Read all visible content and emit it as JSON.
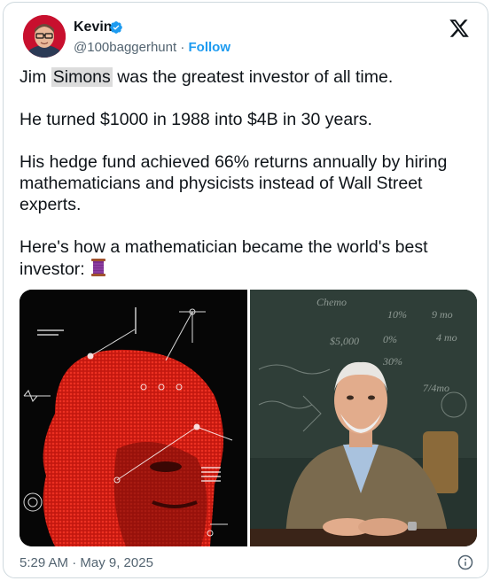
{
  "author": {
    "name": "Kevin",
    "handle": "@100baggerhunt",
    "separator": "·",
    "follow_label": "Follow"
  },
  "tweet": {
    "line1_pre": "Jim ",
    "line1_highlight": "Simons",
    "line1_post": " was the greatest investor of all time.",
    "paragraph2": "He turned $1000 in 1988 into $4B in 30 years.",
    "paragraph3": "His hedge fund achieved 66% returns annually by hiring mathematicians and physicists instead of Wall Street experts.",
    "paragraph4": "Here's how a mathematician became the world's best investor:"
  },
  "media": {
    "left_image": "red-halftone-portrait",
    "right_image": "portrait-at-chalkboard",
    "chalk_text": [
      "Chemo",
      "10%",
      "9 mo",
      "0%",
      "4 mo",
      "30%",
      "7/4mo",
      "$5,000"
    ]
  },
  "footer": {
    "timestamp": "5:29 AM · May 9, 2025"
  },
  "icons": {
    "verified": "verified-badge-icon",
    "x": "x-logo-icon",
    "info": "info-icon",
    "spool": "thread-spool-icon"
  },
  "colors": {
    "accent": "#1d9bf0",
    "text": "#0f1419",
    "muted": "#536471",
    "red": "#d8281e"
  }
}
